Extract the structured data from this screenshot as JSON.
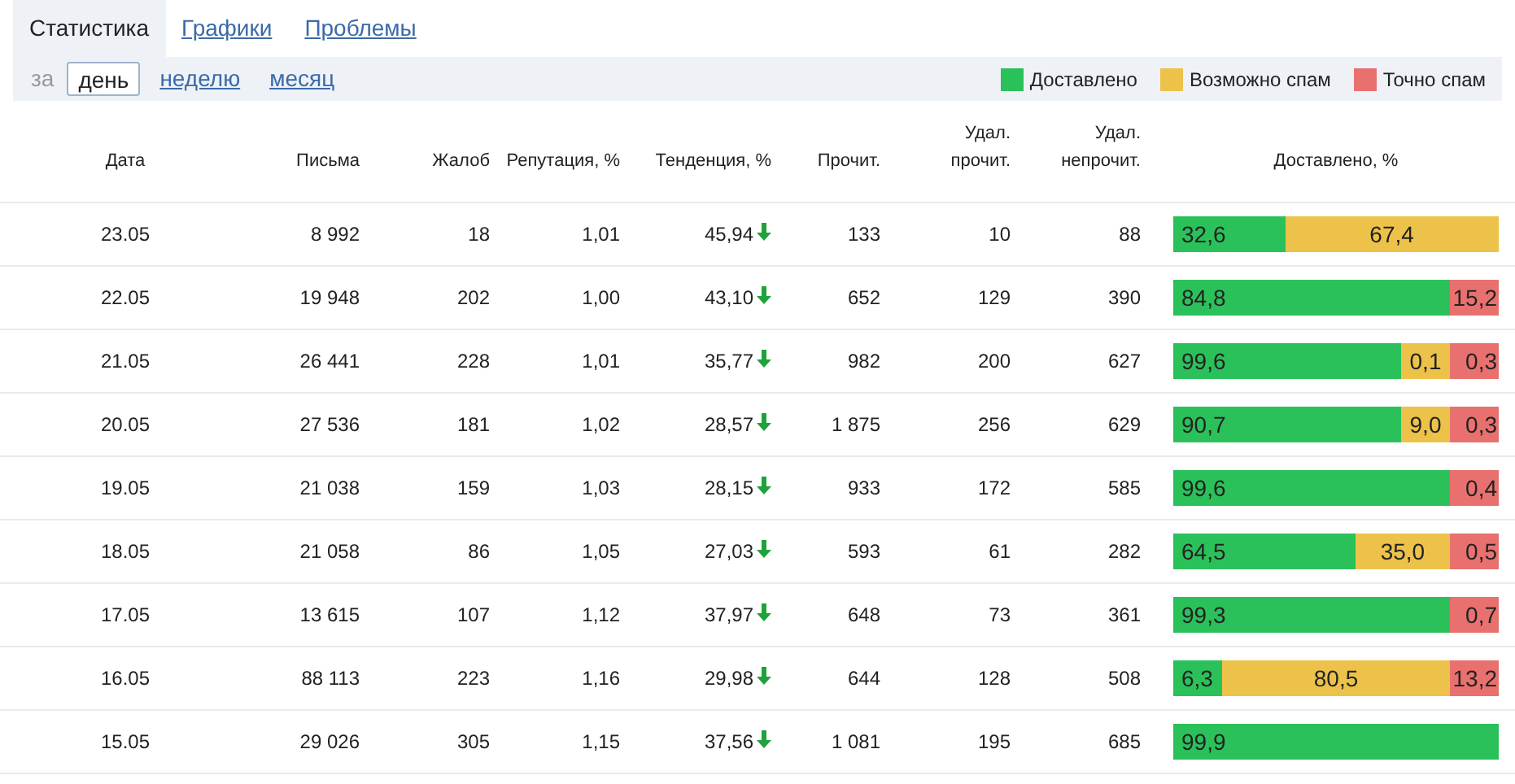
{
  "tabs": [
    {
      "label": "Статистика",
      "selected": true
    },
    {
      "label": "Графики",
      "selected": false
    },
    {
      "label": "Проблемы",
      "selected": false
    }
  ],
  "period": {
    "label": "за",
    "options": [
      {
        "label": "день",
        "selected": true
      },
      {
        "label": "неделю",
        "selected": false
      },
      {
        "label": "месяц",
        "selected": false
      }
    ]
  },
  "legend": [
    {
      "label": "Доставлено",
      "color": "#2bc15a"
    },
    {
      "label": "Возможно спам",
      "color": "#ecc24a"
    },
    {
      "label": "Точно спам",
      "color": "#e8716f"
    }
  ],
  "table": {
    "columns": [
      "Дата",
      "Письма",
      "Жалоб",
      "Репутация, %",
      "Тенденция, %",
      "Прочит.",
      "Удал. прочит.",
      "Удал. непрочит.",
      "Доставлено, %"
    ],
    "rows": [
      {
        "date": "23.05",
        "letters": "8 992",
        "complaints": "18",
        "reputation": "1,01",
        "trend": "45,94",
        "falling": true,
        "read": "133",
        "deleted_read": "10",
        "deleted_unread": "88",
        "delivered": [
          {
            "kind": "delivered",
            "value": "32,6"
          },
          {
            "kind": "maybe_spam",
            "value": "67,4"
          }
        ]
      },
      {
        "date": "22.05",
        "letters": "19 948",
        "complaints": "202",
        "reputation": "1,00",
        "trend": "43,10",
        "falling": true,
        "read": "652",
        "deleted_read": "129",
        "deleted_unread": "390",
        "delivered": [
          {
            "kind": "delivered",
            "value": "84,8"
          },
          {
            "kind": "spam",
            "value": "15,2"
          }
        ]
      },
      {
        "date": "21.05",
        "letters": "26 441",
        "complaints": "228",
        "reputation": "1,01",
        "trend": "35,77",
        "falling": true,
        "read": "982",
        "deleted_read": "200",
        "deleted_unread": "627",
        "delivered": [
          {
            "kind": "delivered",
            "value": "99,6"
          },
          {
            "kind": "maybe_spam",
            "value": "0,1"
          },
          {
            "kind": "spam",
            "value": "0,3"
          }
        ]
      },
      {
        "date": "20.05",
        "letters": "27 536",
        "complaints": "181",
        "reputation": "1,02",
        "trend": "28,57",
        "falling": true,
        "read": "1 875",
        "deleted_read": "256",
        "deleted_unread": "629",
        "delivered": [
          {
            "kind": "delivered",
            "value": "90,7"
          },
          {
            "kind": "maybe_spam",
            "value": "9,0"
          },
          {
            "kind": "spam",
            "value": "0,3"
          }
        ]
      },
      {
        "date": "19.05",
        "letters": "21 038",
        "complaints": "159",
        "reputation": "1,03",
        "trend": "28,15",
        "falling": true,
        "read": "933",
        "deleted_read": "172",
        "deleted_unread": "585",
        "delivered": [
          {
            "kind": "delivered",
            "value": "99,6"
          },
          {
            "kind": "spam",
            "value": "0,4"
          }
        ]
      },
      {
        "date": "18.05",
        "letters": "21 058",
        "complaints": "86",
        "reputation": "1,05",
        "trend": "27,03",
        "falling": true,
        "read": "593",
        "deleted_read": "61",
        "deleted_unread": "282",
        "delivered": [
          {
            "kind": "delivered",
            "value": "64,5"
          },
          {
            "kind": "maybe_spam",
            "value": "35,0"
          },
          {
            "kind": "spam",
            "value": "0,5"
          }
        ]
      },
      {
        "date": "17.05",
        "letters": "13 615",
        "complaints": "107",
        "reputation": "1,12",
        "trend": "37,97",
        "falling": true,
        "read": "648",
        "deleted_read": "73",
        "deleted_unread": "361",
        "delivered": [
          {
            "kind": "delivered",
            "value": "99,3"
          },
          {
            "kind": "spam",
            "value": "0,7"
          }
        ]
      },
      {
        "date": "16.05",
        "letters": "88 113",
        "complaints": "223",
        "reputation": "1,16",
        "trend": "29,98",
        "falling": true,
        "read": "644",
        "deleted_read": "128",
        "deleted_unread": "508",
        "delivered": [
          {
            "kind": "delivered",
            "value": "6,3"
          },
          {
            "kind": "maybe_spam",
            "value": "80,5"
          },
          {
            "kind": "spam",
            "value": "13,2"
          }
        ]
      },
      {
        "date": "15.05",
        "letters": "29 026",
        "complaints": "305",
        "reputation": "1,15",
        "trend": "37,56",
        "falling": true,
        "read": "1 081",
        "deleted_read": "195",
        "deleted_unread": "685",
        "delivered": [
          {
            "kind": "delivered",
            "value": "99,9"
          }
        ]
      }
    ]
  }
}
